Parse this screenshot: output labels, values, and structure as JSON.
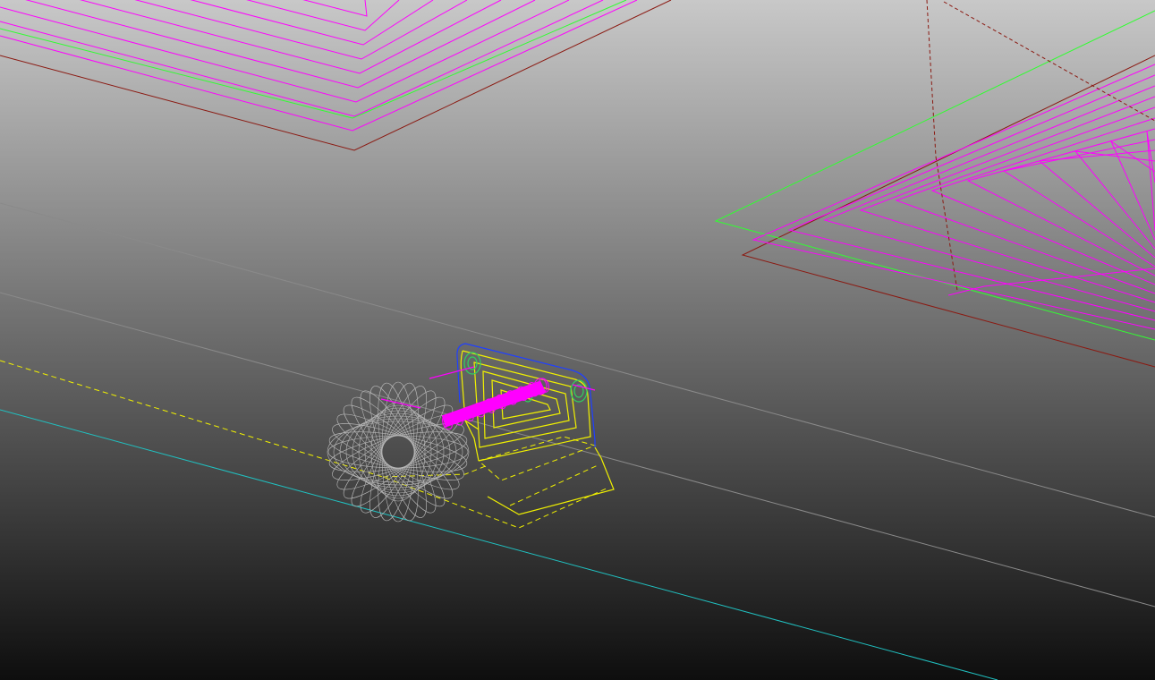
{
  "viewport": {
    "description_visible_text": "",
    "background": {
      "top_color": "#c8c8c8",
      "bottom_color": "#0e0e0e"
    }
  },
  "colors": {
    "toolpath_offsets": "#ff00ff",
    "stock_boundary_green": "#30ff30",
    "part_boundary_red": "#8b1a12",
    "reference_lines_gray": "#8a8a8a",
    "fixture_yellow": "#f0f000",
    "tool_blue": "#2040ff",
    "axis_cyan": "#20c0c0",
    "tool_ghost_gray": "#b8b8b8",
    "hole_green": "#30d060"
  },
  "scene": {
    "objects": [
      "upper-left-toolpath-pocket",
      "right-toolpath-pocket",
      "center-part-fixture",
      "cutting-tool-path",
      "tool-ghost",
      "reference-lines"
    ]
  }
}
